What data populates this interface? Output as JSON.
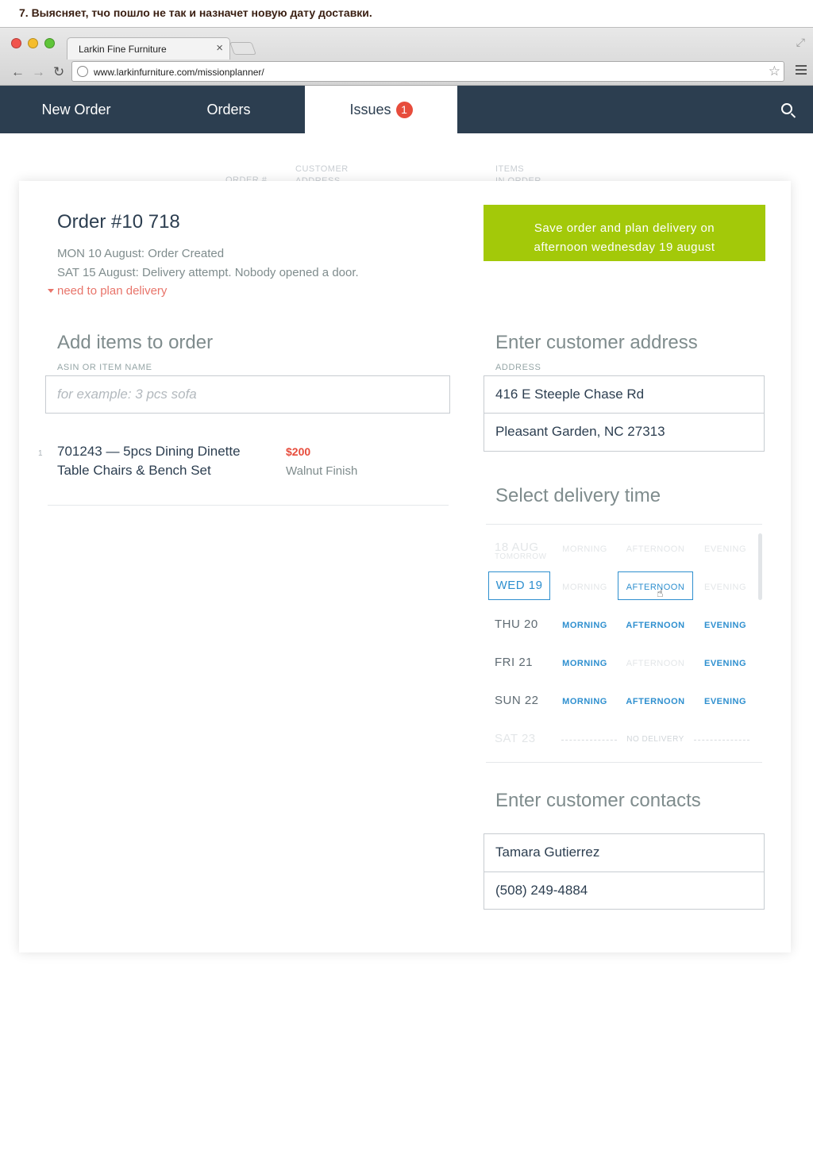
{
  "caption": "7. Выясняет, тчо пошло не так и назначет новую дату доставки.",
  "browser": {
    "tab_title": "Larkin Fine Furniture",
    "tab_close": "×",
    "url": "www.larkinfurniture.com/missionplanner/"
  },
  "nav": {
    "tabs": [
      {
        "label": "New Order"
      },
      {
        "label": "Orders"
      },
      {
        "label": "Issues",
        "badge": "1"
      }
    ],
    "active_tab": "Issues"
  },
  "background_header": {
    "order_col": "ORDER #",
    "customer_col_1": "CUSTOMER",
    "customer_col_2": "ADDRESS",
    "items_col_1": "ITEMS",
    "items_col_2": "IN ORDER"
  },
  "order": {
    "title": "Order #10 718",
    "history": [
      "MON 10 August: Order Created",
      "SAT 15 August: Delivery attempt. Nobody opened a door."
    ],
    "need_plan": "need to plan delivery",
    "save_button_line1": "Save order and plan delivery on",
    "save_button_line2": "afternoon wednesday 19 august"
  },
  "items_section": {
    "title": "Add items to order",
    "field_label": "ASIN OR ITEM NAME",
    "placeholder": "for example: 3 pcs sofa",
    "items": [
      {
        "index": "1",
        "name": "701243 — 5pcs Dining Dinette Table Chairs & Bench Set",
        "price": "$200",
        "finish": "Walnut Finish"
      }
    ]
  },
  "address_section": {
    "title": "Enter customer address",
    "field_label": "ADDRESS",
    "line1": "416 E Steeple Chase Rd",
    "line2": "Pleasant Garden, NC 27313"
  },
  "delivery_section": {
    "title": "Select delivery time",
    "slot_names": {
      "morning": "MORNING",
      "afternoon": "AFTERNOON",
      "evening": "EVENING"
    },
    "rows": [
      {
        "day": "18 AUG",
        "sub": "TOMORROW",
        "morning": "unavailable",
        "afternoon": "unavailable",
        "evening": "unavailable"
      },
      {
        "day": "WED 19",
        "morning": "unavailable",
        "afternoon": "selected",
        "evening": "unavailable"
      },
      {
        "day": "THU 20",
        "morning": "available",
        "afternoon": "available",
        "evening": "available"
      },
      {
        "day": "FRI 21",
        "morning": "available",
        "afternoon": "unavailable",
        "evening": "available"
      },
      {
        "day": "SUN 22",
        "morning": "available",
        "afternoon": "available",
        "evening": "available"
      },
      {
        "day": "SAT 23",
        "note": "NO DELIVERY"
      }
    ],
    "selected_day": "WED 19",
    "selected_slot": "AFTERNOON"
  },
  "contacts_section": {
    "title": "Enter customer contacts",
    "name": "Tamara Gutierrez",
    "phone": "(508) 249-4884"
  },
  "colors": {
    "nav_bg": "#2c3e50",
    "accent_green": "#a3c909",
    "link_blue": "#2e8fcf",
    "badge_red": "#e74c3c",
    "warning_salmon": "#e8746a"
  }
}
